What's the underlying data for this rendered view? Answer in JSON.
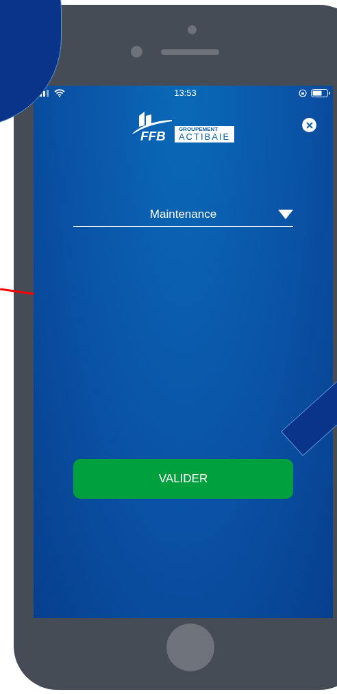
{
  "status_bar": {
    "time": "13:53"
  },
  "logo": {
    "mark": "FFB",
    "group": "GROUPEMENT",
    "name": "ACTIBAIE"
  },
  "dropdown": {
    "value": "Maintenance"
  },
  "button": {
    "label": "VALIDER"
  }
}
